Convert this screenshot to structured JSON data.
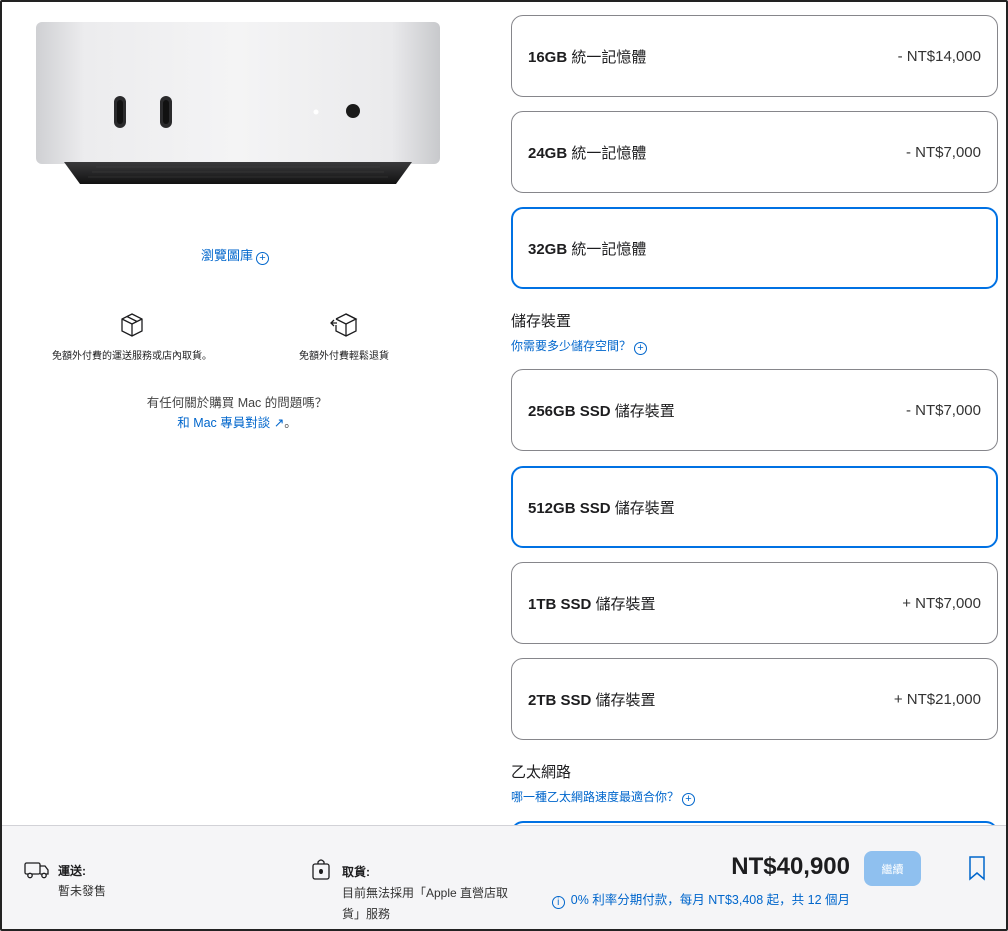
{
  "left": {
    "gallery_link": "瀏覽圖庫",
    "features": [
      {
        "icon": "box-icon",
        "text": "免額外付費的運送服務或店內取貨。"
      },
      {
        "icon": "return-box-icon",
        "text": "免額外付費輕鬆退貨"
      }
    ],
    "help_question": "有任何關於購買 Mac 的問題嗎？",
    "help_link": "和 Mac 專員對談",
    "help_suffix": "。"
  },
  "memory": {
    "options": [
      {
        "size": "16GB",
        "label": "統一記憶體",
        "price": "- NT$14,000",
        "selected": false
      },
      {
        "size": "24GB",
        "label": "統一記憶體",
        "price": "- NT$7,000",
        "selected": false
      },
      {
        "size": "32GB",
        "label": "統一記憶體",
        "price": "",
        "selected": true
      }
    ]
  },
  "storage": {
    "title": "儲存裝置",
    "help": "你需要多少儲存空間？",
    "options": [
      {
        "size": "256GB SSD",
        "label": "儲存裝置",
        "price": "- NT$7,000",
        "selected": false
      },
      {
        "size": "512GB SSD",
        "label": "儲存裝置",
        "price": "",
        "selected": true
      },
      {
        "size": "1TB SSD",
        "label": "儲存裝置",
        "price": "+ NT$7,000",
        "selected": false
      },
      {
        "size": "2TB SSD",
        "label": "儲存裝置",
        "price": "+ NT$21,000",
        "selected": false
      }
    ]
  },
  "ethernet": {
    "title": "乙太網路",
    "help": "哪一種乙太網路速度最適合你？"
  },
  "footer": {
    "shipping_label": "運送:",
    "shipping_value": "暫未發售",
    "pickup_label": "取貨:",
    "pickup_value": "目前無法採用「Apple 直營店取貨」服務",
    "total": "NT$40,900",
    "installment": "0% 利率分期付款，每月 NT$3,408 起，共 12 個月",
    "continue_label": "繼續"
  },
  "colors": {
    "accent": "#0071e3",
    "link": "#0066cc",
    "border": "#86868b",
    "footer_bg": "#f5f5f7"
  }
}
